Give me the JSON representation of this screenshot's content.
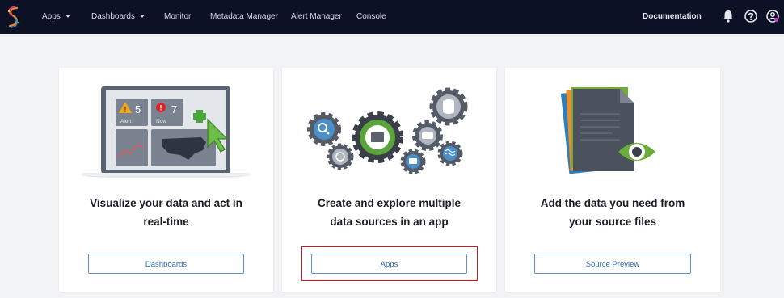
{
  "topbar": {
    "nav": [
      {
        "label": "Apps",
        "has_dropdown": true
      },
      {
        "label": "Dashboards",
        "has_dropdown": true
      },
      {
        "label": "Monitor",
        "has_dropdown": false
      },
      {
        "label": "Metadata Manager",
        "has_dropdown": false
      },
      {
        "label": "Alert Manager",
        "has_dropdown": false
      },
      {
        "label": "Console",
        "has_dropdown": false
      }
    ],
    "documentation": "Documentation",
    "icons": [
      "bell-icon",
      "help-icon",
      "user-settings-icon"
    ]
  },
  "cards": [
    {
      "title_line1": "Visualize your data and act in",
      "title_line2": "real-time",
      "button_label": "Dashboards",
      "illustration": {
        "alert_count": "5",
        "alert_label": "Alert",
        "now_count": "7",
        "now_label": "Now"
      }
    },
    {
      "title_line1": "Create and explore multiple",
      "title_line2": "data sources in an app",
      "button_label": "Apps"
    },
    {
      "title_line1": "Add the data you need from",
      "title_line2": "your source files",
      "button_label": "Source Preview"
    }
  ],
  "colors": {
    "topbar": "#0d1126",
    "page_bg": "#f2f3f5",
    "button_border": "#5e92cf",
    "button_text": "#2d6bb6",
    "highlight": "#e0101e"
  }
}
